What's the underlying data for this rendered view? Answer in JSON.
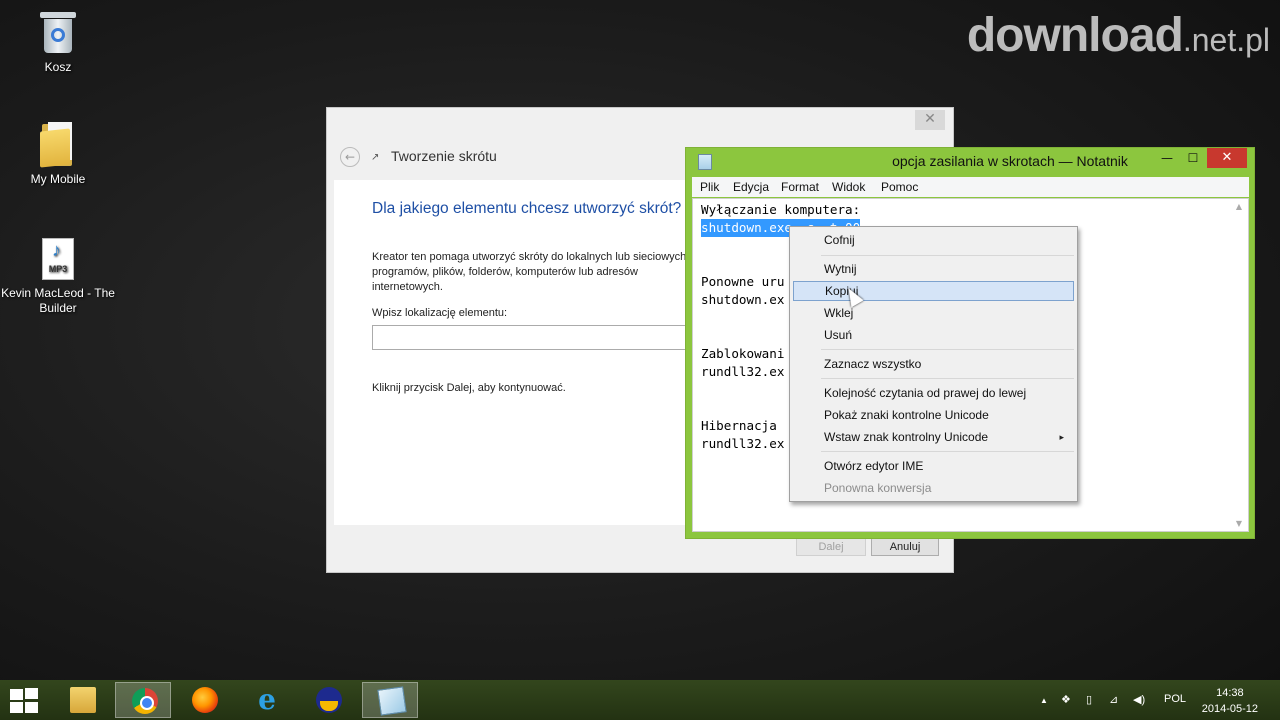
{
  "watermark": {
    "brand": "download",
    "tld": ".net.pl"
  },
  "desktop": {
    "icons": [
      {
        "label": "Kosz",
        "icon": "recycle-bin-icon"
      },
      {
        "label": "My Mobile",
        "icon": "folder-icon"
      },
      {
        "label": "Kevin MacLeod - The Builder",
        "icon": "mp3-file-icon",
        "badge": "MP3"
      }
    ]
  },
  "wizard": {
    "close_glyph": "✕",
    "title": "Tworzenie skrótu",
    "question": "Dla jakiego elementu chcesz utworzyć skrót?",
    "description": "Kreator ten pomaga utworzyć skróty do lokalnych lub sieciowych programów, plików, folderów, komputerów lub adresów internetowych.",
    "location_label": "Wpisz lokalizację elementu:",
    "location_value": "",
    "hint": "Kliknij przycisk Dalej, aby kontynuować.",
    "next_label": "Dalej",
    "cancel_label": "Anuluj"
  },
  "notepad": {
    "title": "opcja zasilania w skrotach — Notatnik",
    "minimize_glyph": "—",
    "maximize_glyph": "☐",
    "close_glyph": "✕",
    "menu": [
      "Plik",
      "Edycja",
      "Format",
      "Widok",
      "Pomoc"
    ],
    "lines": {
      "l1": "Wyłączanie komputera:",
      "l2_selected": "shutdown.exe -s -t 00",
      "l3": "Ponowne uru",
      "l4": "shutdown.ex",
      "l5": "Zablokowani",
      "l6": "rundll32.ex",
      "l7": "Hibernacja",
      "l8": "rundll32.ex"
    }
  },
  "context_menu": {
    "undo": "Cofnij",
    "cut": "Wytnij",
    "copy": "Kopiuj",
    "paste": "Wklej",
    "delete": "Usuń",
    "select_all": "Zaznacz wszystko",
    "rtl": "Kolejność czytania od prawej do lewej",
    "show_unicode": "Pokaż znaki kontrolne Unicode",
    "insert_unicode": "Wstaw znak kontrolny Unicode",
    "submenu_arrow": "▸",
    "open_ime": "Otwórz edytor IME",
    "reconversion": "Ponowna konwersja"
  },
  "taskbar": {
    "apps": [
      "file-explorer-icon",
      "chrome-icon",
      "firefox-icon",
      "internet-explorer-icon",
      "audio-player-icon",
      "notepad-icon"
    ],
    "tray_arrow": "▲",
    "language": "POL",
    "time": "14:38",
    "date": "2014-05-12"
  },
  "colors": {
    "notepad_frame": "#8cc63e",
    "selection": "#3399ff",
    "taskbar": "#2a3d16",
    "wizard_heading": "#1e4fa5"
  }
}
